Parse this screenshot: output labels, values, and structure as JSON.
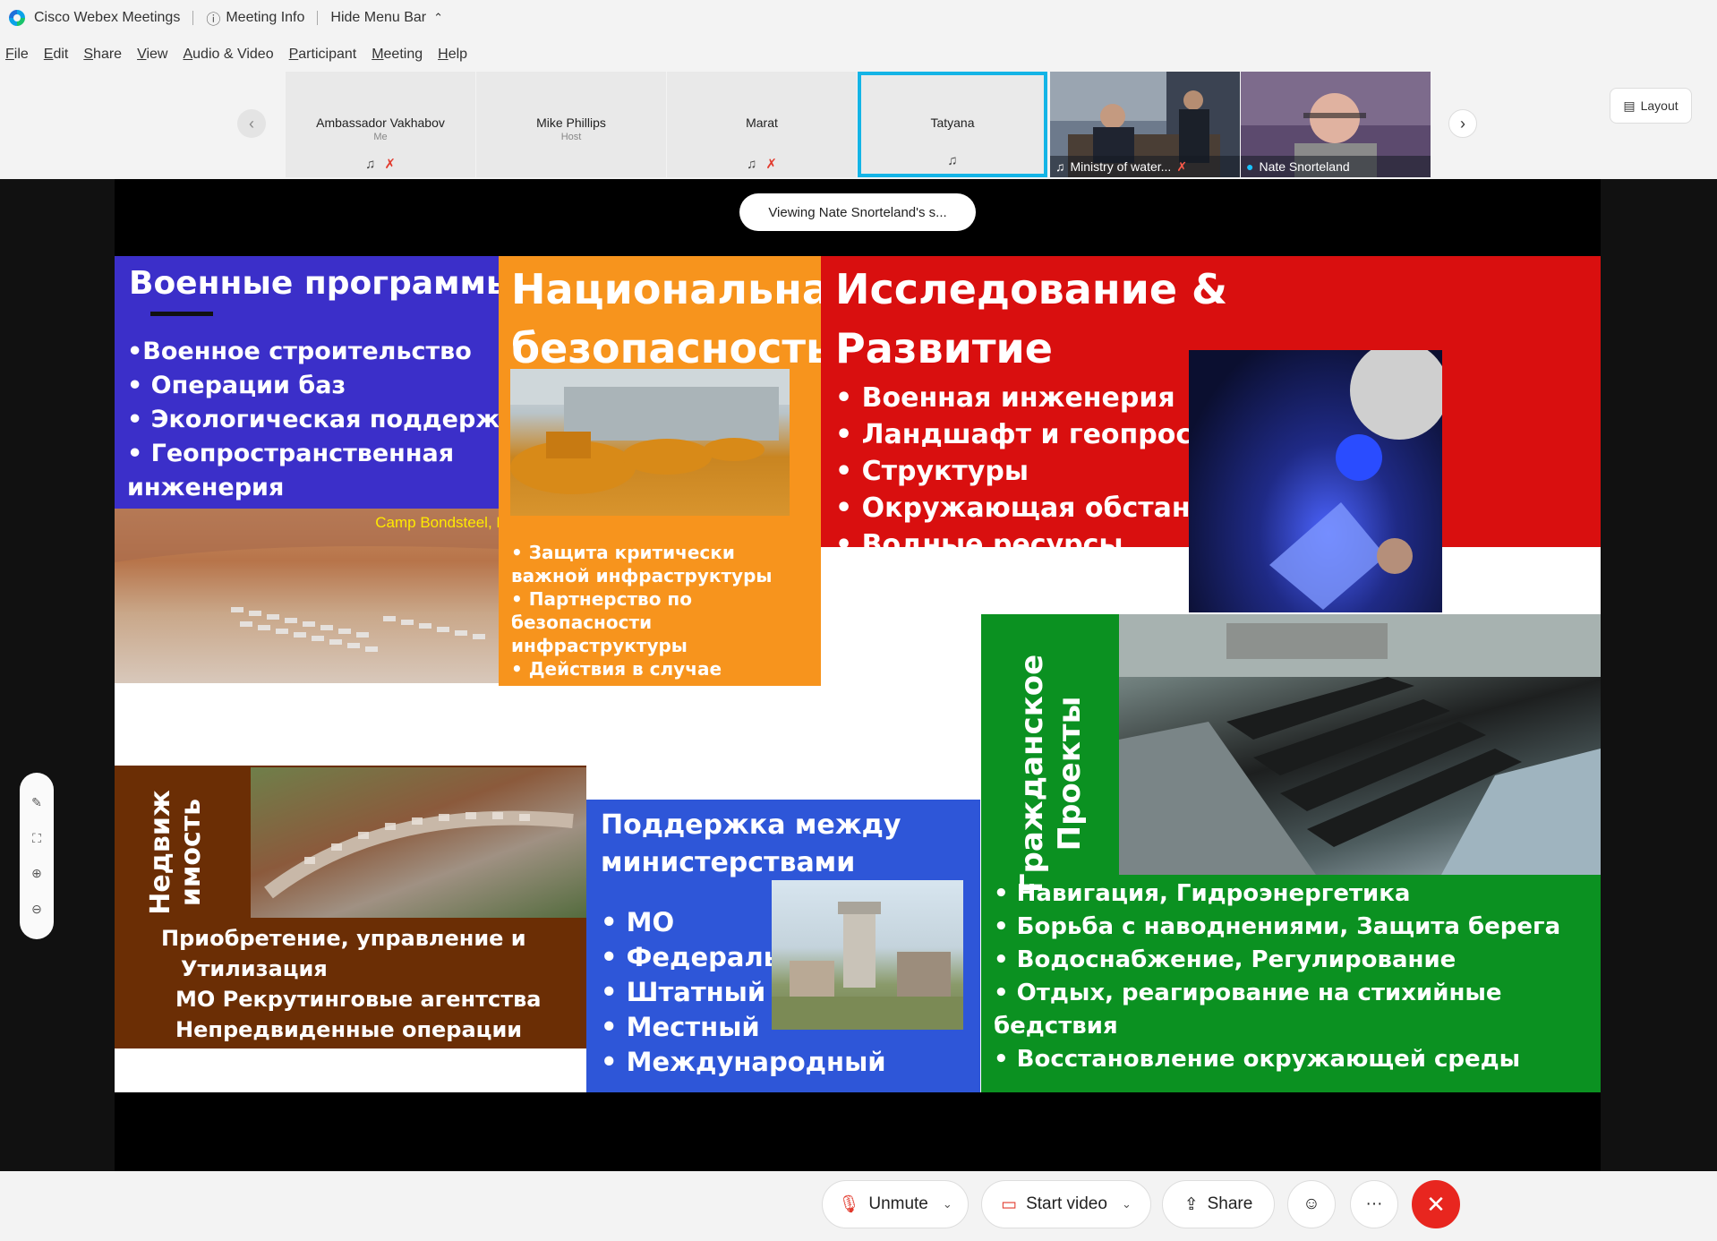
{
  "app": {
    "title": "Cisco Webex Meetings",
    "meeting_info": "Meeting Info",
    "hide_menu": "Hide Menu Bar"
  },
  "menu": [
    "File",
    "Edit",
    "Share",
    "View",
    "Audio & Video",
    "Participant",
    "Meeting",
    "Help"
  ],
  "participants": [
    {
      "name": "Ambassador Vakhabov",
      "sub": "Me"
    },
    {
      "name": "Mike Phillips",
      "sub": "Host"
    },
    {
      "name": "Marat",
      "sub": ""
    },
    {
      "name": "Tatyana",
      "sub": ""
    },
    {
      "name": "Ministry of water...",
      "sub": ""
    },
    {
      "name": "Nate Snorteland",
      "sub": ""
    }
  ],
  "layout_label": "Layout",
  "viewing_text": "Viewing Nate Snorteland's s...",
  "slide": {
    "military": {
      "title": "Военные программы",
      "items": [
        "•Военное строительство",
        "•  Операции баз",
        "•  Экологическая поддержка",
        "•  Геопространственная инженерия"
      ],
      "photo_caption": "Camp Bondsteel, Kosovo, Oct"
    },
    "national": {
      "title_l1": "Национальная",
      "title_l2": "безопасность",
      "items": [
        "• Защита критически важной инфраструктуры",
        "•  Партнерство по безопасности инфраструктуры",
        "•  Действия в случае непредвиденных обстоятельств и стихийных бедствий"
      ]
    },
    "research": {
      "title_l1": "Исследование &",
      "title_l2": "Развитие",
      "items": [
        "• Военная инженерия",
        "• Ландшафт и геопрост",
        "• Структуры",
        "• Окружающая обстанс",
        "• Водные ресурсы"
      ]
    },
    "realestate": {
      "title_l1": "Недвиж",
      "title_l2": "имость",
      "items": [
        "Приобретение, управление и",
        "Утилизация",
        "МО Рекрутинговые агентства",
        "Непредвиденные операции"
      ]
    },
    "interagency": {
      "title_l1": "Поддержка между",
      "title_l2": "министерствами",
      "items": [
        "• МО",
        "• Федералы",
        "•  Штатный",
        "•  Местный",
        "•  Международный"
      ]
    },
    "civil": {
      "title_l1": "Гражданское",
      "title_l2": "Проекты",
      "items": [
        "• Навигация, Гидроэнергетика",
        "•  Борьба с наводнениями, Защита берега",
        "•  Водоснабжение, Регулирование",
        "•  Отдых, реагирование на стихийные бедствия",
        "•  Восстановление окружающей среды"
      ]
    }
  },
  "controls": {
    "unmute": "Unmute",
    "start_video": "Start video",
    "share": "Share"
  }
}
